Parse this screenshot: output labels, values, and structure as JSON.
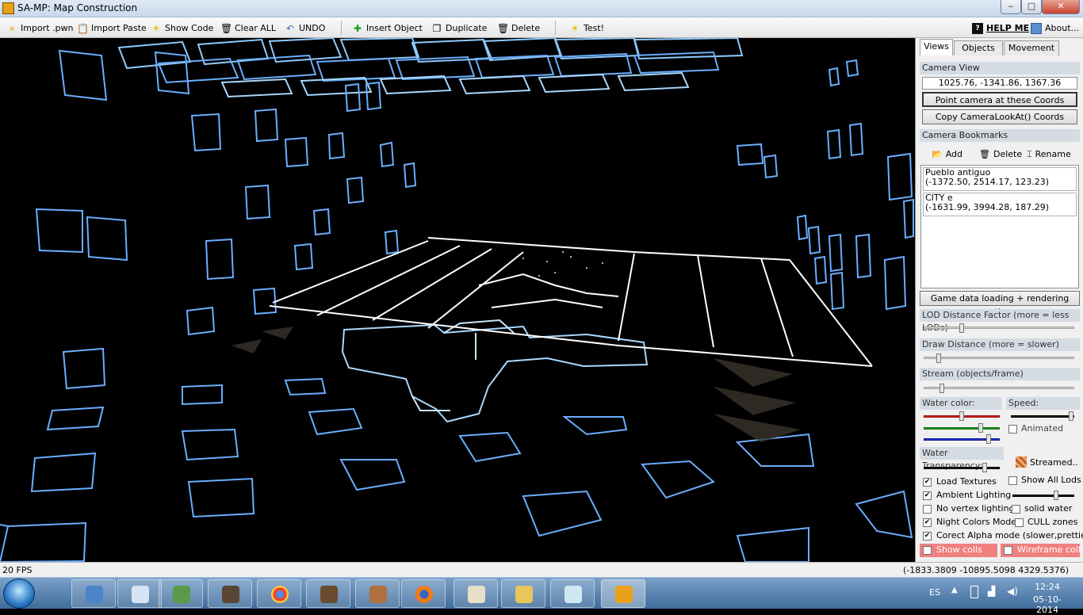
{
  "window": {
    "title": "SA-MP: Map Construction",
    "min": "‒",
    "max": "□",
    "close": "✕"
  },
  "toolbar": {
    "import_pwn": "Import .pwn",
    "import_paste": "Import Paste",
    "show_code": "Show Code",
    "clear_all": "Clear ALL",
    "undo": "UNDO",
    "insert_object": "Insert Object",
    "duplicate": "Duplicate",
    "delete": "Delete",
    "test": "Test!",
    "help_me": "HELP ME",
    "about": "About..."
  },
  "panel": {
    "tabs": [
      "Views",
      "Objects",
      "Movement"
    ],
    "camera_view_header": "Camera View",
    "camera_coords": "1025.76, -1341.86, 1367.36",
    "point_camera_button": "Point camera at these Coords",
    "copy_lookat_button": "Copy CameraLookAt() Coords",
    "bookmarks_header": "Camera Bookmarks",
    "bookmark_add": "Add",
    "bookmark_delete": "Delete",
    "bookmark_rename": "Rename",
    "bookmarks": [
      {
        "name": "Pueblo antiguo",
        "coords": "(-1372.50, 2514.17, 123.23)"
      },
      {
        "name": "CITY e",
        "coords": "(-1631.99, 3994.28, 187.29)"
      }
    ],
    "render_options_header": "Game data loading + rendering options",
    "lod_label": "LOD Distance Factor (more = less LODs)",
    "lod_level": 0.25,
    "draw_distance_label": "Draw Distance (more = slower)",
    "draw_distance_level": 0.1,
    "stream_label": "Stream (objects/frame)",
    "stream_level": 0.12,
    "water_color_label": "Water color:",
    "speed_label": "Speed:",
    "water_red": 0.5,
    "water_green": 0.75,
    "water_blue": 0.85,
    "speed_level": 0.95,
    "animated_label": "Animated",
    "water_transparency_label": "Water Transparency:",
    "water_transparency_level": 0.8,
    "streamed_label": "Streamed..",
    "options": [
      {
        "label": "Load Textures",
        "checked": true
      },
      {
        "label": "Show All Lods",
        "checked": false
      },
      {
        "label": "Ambient Lighting",
        "checked": true
      },
      {
        "label": "No vertex lighting",
        "checked": false
      },
      {
        "label": "solid water",
        "checked": false
      },
      {
        "label": "Night Colors Mode",
        "checked": true
      },
      {
        "label": "CULL zones",
        "checked": false
      },
      {
        "label": "Corect Alpha mode (slower,prettier)",
        "checked": true
      },
      {
        "label": "Show colls",
        "checked": false
      },
      {
        "label": "Wireframe colls",
        "checked": false
      }
    ],
    "ambient_level": 0.7
  },
  "status": {
    "fps": "20 FPS",
    "coords": "(-1833.3809 -10895.5098 4329.5376)"
  },
  "taskbar": {
    "language": "ES",
    "time": "12:24",
    "date": "05-10-2014"
  },
  "colors": {
    "accent": "#6aaeff",
    "water_red": "#d02020",
    "water_green": "#20a020",
    "water_blue": "#2030d0",
    "collision_bg": "#f08080"
  }
}
